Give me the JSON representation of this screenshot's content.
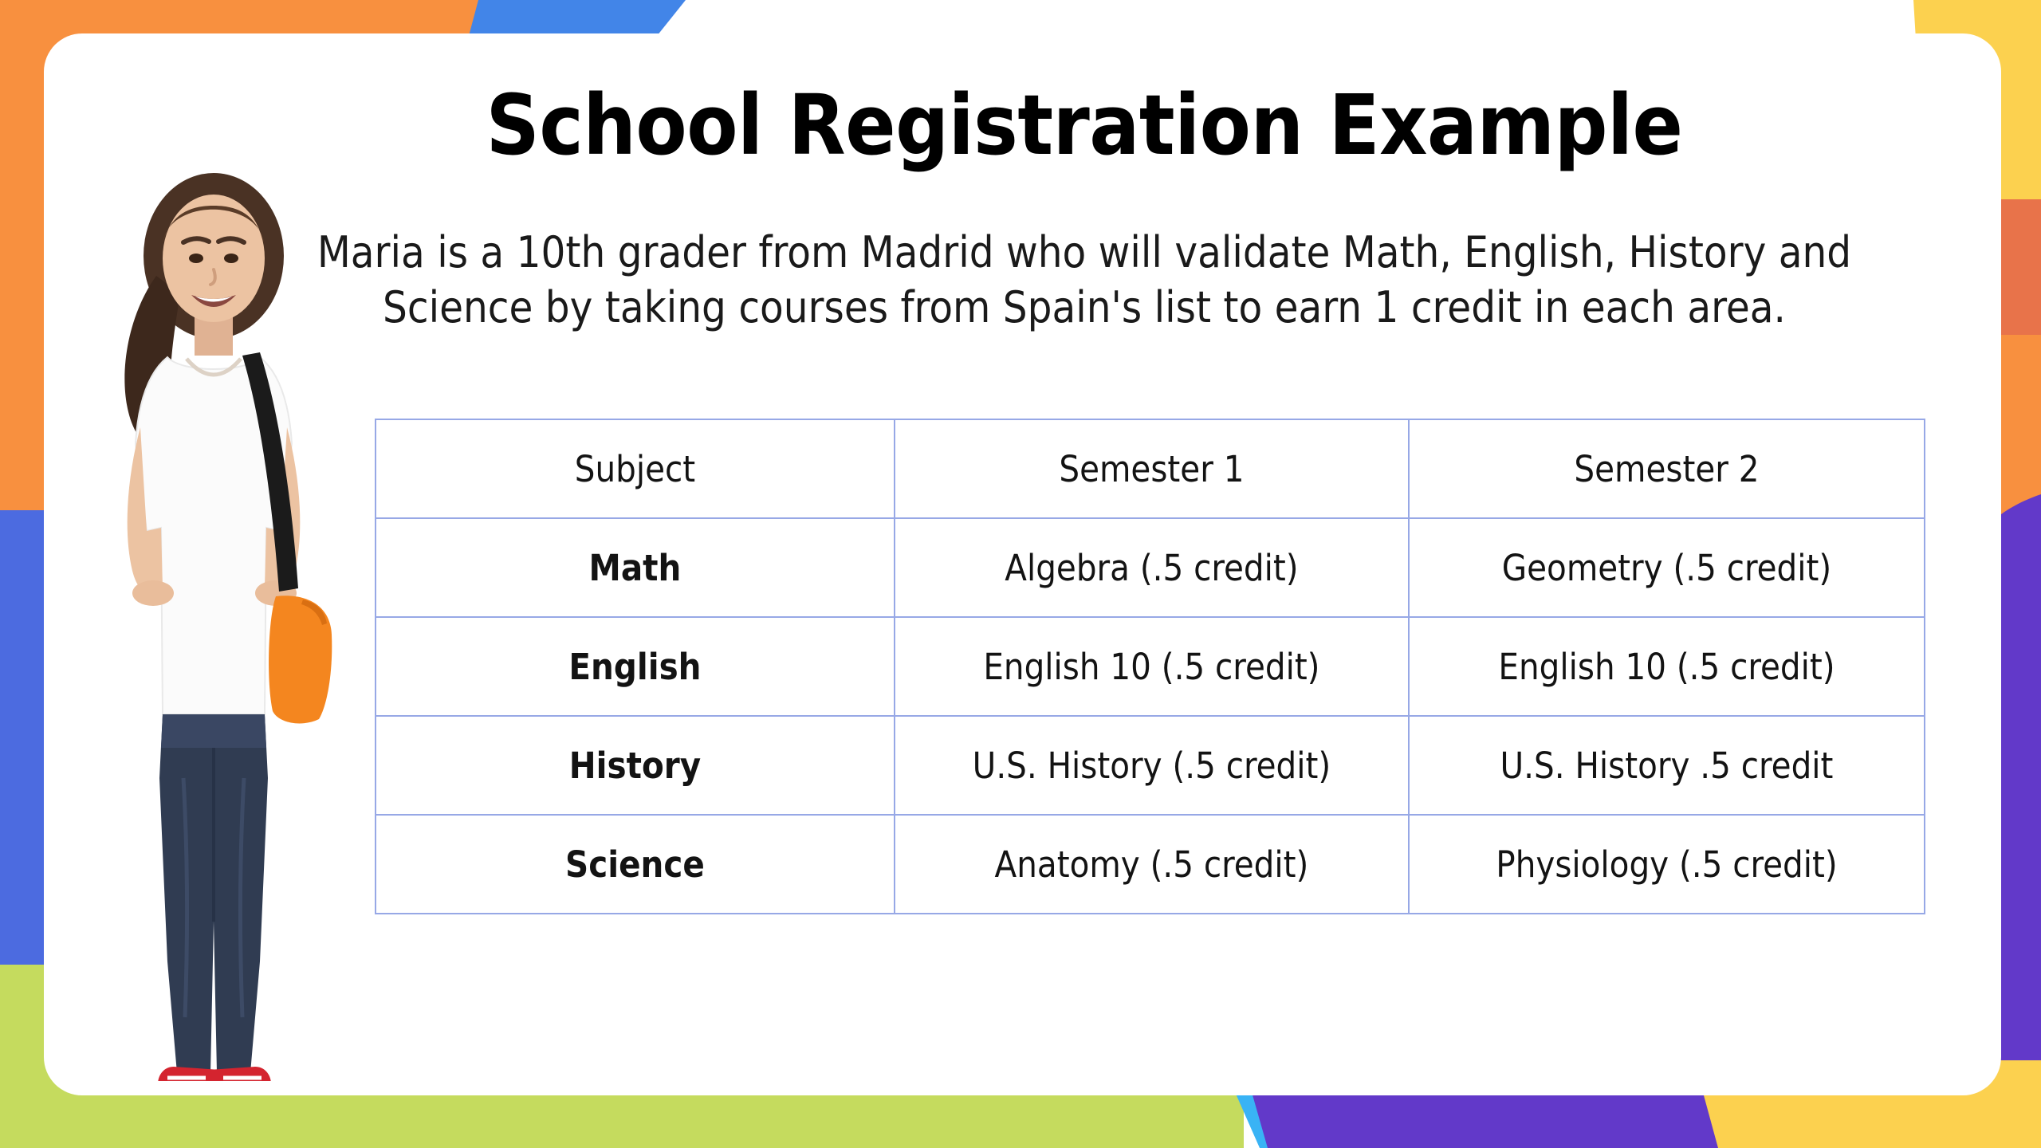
{
  "slide": {
    "title": "School Registration Example",
    "subtitle": "Maria is a 10th grader from Madrid who will validate Math, English, History and Science by taking courses from Spain's list to earn 1 credit in each area."
  },
  "table": {
    "headers": [
      "Subject",
      "Semester 1",
      "Semester 2"
    ],
    "rows": [
      {
        "subject": "Math",
        "semester1": "Algebra (.5 credit)",
        "semester2": "Geometry (.5 credit)"
      },
      {
        "subject": "English",
        "semester1": "English 10 (.5 credit)",
        "semester2": "English 10 (.5 credit)"
      },
      {
        "subject": "History",
        "semester1": "U.S. History (.5 credit)",
        "semester2": "U.S.  History .5 credit"
      },
      {
        "subject": "Science",
        "semester1": "Anatomy (.5 credit)",
        "semester2": "Physiology (.5 credit)"
      }
    ]
  },
  "photo": {
    "alt": "student-photo-maria"
  },
  "colors": {
    "card_background": "#ffffff",
    "table_border": "#97a8e6",
    "text": "#000000",
    "decor_orange": "#f8903f",
    "decor_blue": "#4285e8",
    "decor_yellow": "#fcd14f",
    "decor_purple": "#6239c9",
    "decor_indigo": "#4c6be0",
    "decor_lime": "#c5db5e",
    "decor_cyan": "#39b3f5",
    "decor_salmon": "#e8734a"
  }
}
